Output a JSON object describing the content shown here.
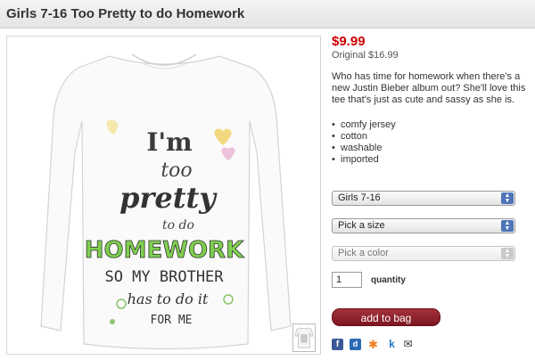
{
  "product": {
    "title": "Girls 7-16 Too Pretty to do Homework",
    "price": "$9.99",
    "original_price": "Original $16.99",
    "description": "Who has time for homework when there's a new Justin Bieber album out? She'll love this tee that's just as cute and sassy as she is.",
    "features": [
      "comfy jersey",
      "cotton",
      "washable",
      "imported"
    ]
  },
  "shirt_print": {
    "line1": "I'm",
    "line2": "too",
    "line3": "pretty",
    "line4": "to do",
    "line5": "HOMEWORK",
    "line6": "SO MY BROTHER",
    "line7": "has to do it",
    "line8": "FOR ME"
  },
  "options": {
    "size_group": "Girls 7-16",
    "size": "Pick a size",
    "color": "Pick a color"
  },
  "quantity": {
    "value": "1",
    "label": "quantity"
  },
  "actions": {
    "add_to_bag": "add to bag"
  },
  "share_icons": [
    "facebook-icon",
    "digg-icon",
    "stumbleupon-icon",
    "kaboodle-icon",
    "email-icon"
  ]
}
